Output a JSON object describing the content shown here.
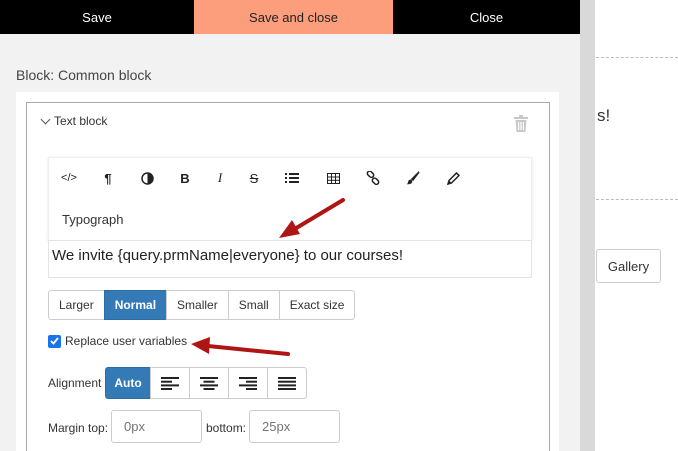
{
  "topbar": {
    "save_label": "Save",
    "save_close_label": "Save and close",
    "close_label": "Close"
  },
  "block_label": "Block: Common block",
  "text_block": {
    "header": "Text block"
  },
  "toolbar": {
    "icons": [
      "code-icon",
      "paragraph-icon",
      "contrast-icon",
      "bold-icon",
      "italic-icon",
      "strikethrough-icon",
      "list-icon",
      "table-icon",
      "link-icon",
      "brush-icon",
      "pencil-icon"
    ],
    "typograph_label": "Typograph"
  },
  "editor": {
    "content": "We invite {query.prmName|everyone} to our courses!"
  },
  "size_buttons": [
    "Larger",
    "Normal",
    "Smaller",
    "Small",
    "Exact size"
  ],
  "size_selected": "Normal",
  "replace_vars": {
    "label": "Replace user variables",
    "checked": true
  },
  "alignment": {
    "label": "Alignment",
    "auto_label": "Auto"
  },
  "margins": {
    "top_label": "Margin top:",
    "top_placeholder": "0px",
    "bottom_label": "bottom:",
    "bottom_placeholder": "25px"
  },
  "background": {
    "text_fragment": "s!",
    "gallery_label": "Gallery"
  },
  "colors": {
    "save_close_bg": "#fc9e7c",
    "active_blue": "#337ab7",
    "arrow_red": "#b01515"
  }
}
